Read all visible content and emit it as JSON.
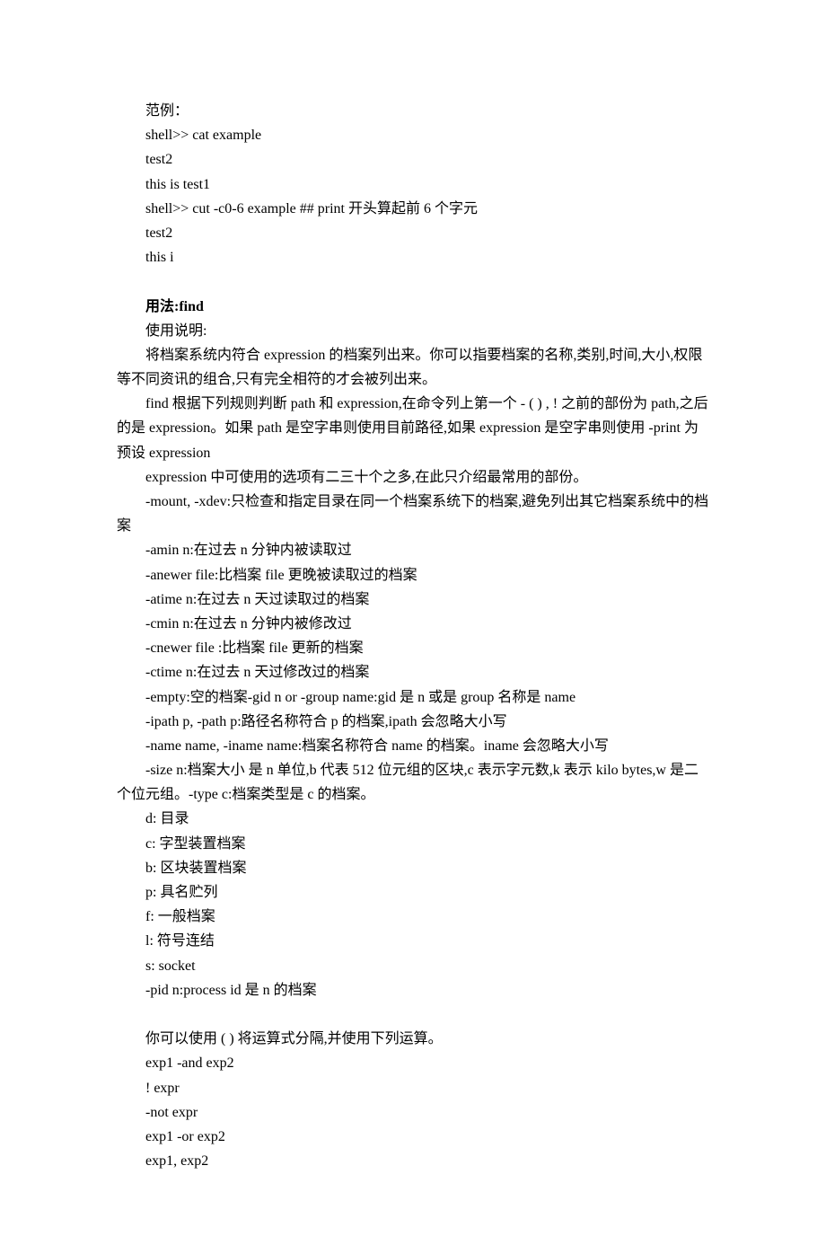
{
  "p1": "范例：",
  "p2": "shell>> cat example",
  "p3": "test2",
  "p4": "this is test1",
  "p5": "shell>> cut -c0-6 example ## print 开头算起前 6 个字元",
  "p6": "test2",
  "p7": "this i",
  "h1": "用法:find",
  "p8": "使用说明:",
  "p9": "将档案系统内符合 expression 的档案列出来。你可以指要档案的名称,类别,时间,大小,权限等不同资讯的组合,只有完全相符的才会被列出来。",
  "p10": "find 根据下列规则判断 path 和 expression,在命令列上第一个 - ( ) , ! 之前的部份为 path,之后的是 expression。如果 path 是空字串则使用目前路径,如果 expression 是空字串则使用 -print 为预设 expression",
  "p11": "expression 中可使用的选项有二三十个之多,在此只介绍最常用的部份。",
  "p12": "-mount, -xdev:只检查和指定目录在同一个档案系统下的档案,避免列出其它档案系统中的档案",
  "p13": "-amin n:在过去 n 分钟内被读取过",
  "p14": "-anewer file:比档案 file 更晚被读取过的档案",
  "p15": "-atime n:在过去 n 天过读取过的档案",
  "p16": "-cmin n:在过去 n 分钟内被修改过",
  "p17": "-cnewer file :比档案 file 更新的档案",
  "p18": "-ctime n:在过去 n 天过修改过的档案",
  "p19": "-empty:空的档案-gid n or -group name:gid 是 n 或是 group 名称是 name",
  "p20": "-ipath p, -path p:路径名称符合 p 的档案,ipath 会忽略大小写",
  "p21": "-name name, -iname name:档案名称符合 name 的档案。iname 会忽略大小写",
  "p22": "-size n:档案大小 是 n 单位,b 代表 512 位元组的区块,c 表示字元数,k 表示 kilo bytes,w 是二个位元组。-type c:档案类型是 c 的档案。",
  "p23": "d: 目录",
  "p24": "c: 字型装置档案",
  "p25": "b: 区块装置档案",
  "p26": "p: 具名贮列",
  "p27": "f: 一般档案",
  "p28": "l: 符号连结",
  "p29": "s: socket",
  "p30": "-pid n:process id 是 n 的档案",
  "p31": "你可以使用 ( ) 将运算式分隔,并使用下列运算。",
  "p32": "exp1 -and exp2",
  "p33": "! expr",
  "p34": "-not expr",
  "p35": "exp1 -or exp2",
  "p36": "exp1, exp2"
}
